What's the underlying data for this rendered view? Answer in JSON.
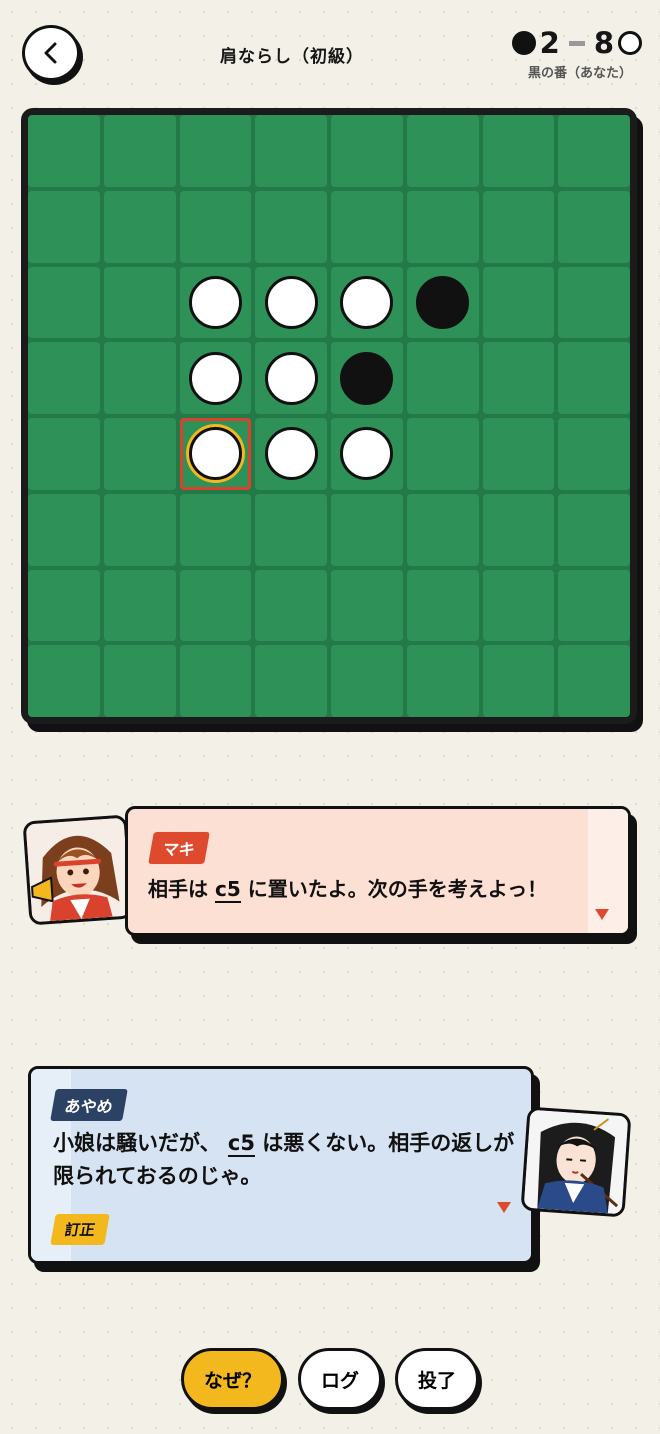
{
  "header": {
    "title": "肩ならし（初級）",
    "score_black": "2",
    "score_white": "8",
    "turn_label": "黒の番（あなた）"
  },
  "board": {
    "rows": [
      [
        "",
        "",
        "",
        "",
        "",
        "",
        "",
        ""
      ],
      [
        "",
        "",
        "",
        "",
        "",
        "",
        "",
        ""
      ],
      [
        "",
        "",
        "W",
        "W",
        "W",
        "B",
        "",
        ""
      ],
      [
        "",
        "",
        "W",
        "W",
        "B",
        "",
        "",
        ""
      ],
      [
        "",
        "",
        "W",
        "W",
        "W",
        "",
        "",
        ""
      ],
      [
        "",
        "",
        "",
        "",
        "",
        "",
        "",
        ""
      ],
      [
        "",
        "",
        "",
        "",
        "",
        "",
        "",
        ""
      ],
      [
        "",
        "",
        "",
        "",
        "",
        "",
        "",
        ""
      ]
    ],
    "last_move": "c5",
    "colors": {
      "board": "#2e9157",
      "highlight_border": "#d9432d",
      "highlight_ring": "#f3b81e"
    }
  },
  "maki": {
    "name": "マキ",
    "message_pre": "相手は",
    "message_code": "c5",
    "message_post": "に置いたよ。次の手を考えよっ！"
  },
  "ayame": {
    "name": "あやめ",
    "message_pre": "小娘は騒いだが、",
    "message_code": "c5",
    "message_post": "は悪くない。相手の返しが限られておるのじゃ。",
    "badge": "訂正"
  },
  "buttons": {
    "why": "なぜ？",
    "log": "ログ",
    "resign": "投了"
  },
  "icons": {
    "back": "chevron-left-icon",
    "continue": "triangle-down-icon"
  }
}
